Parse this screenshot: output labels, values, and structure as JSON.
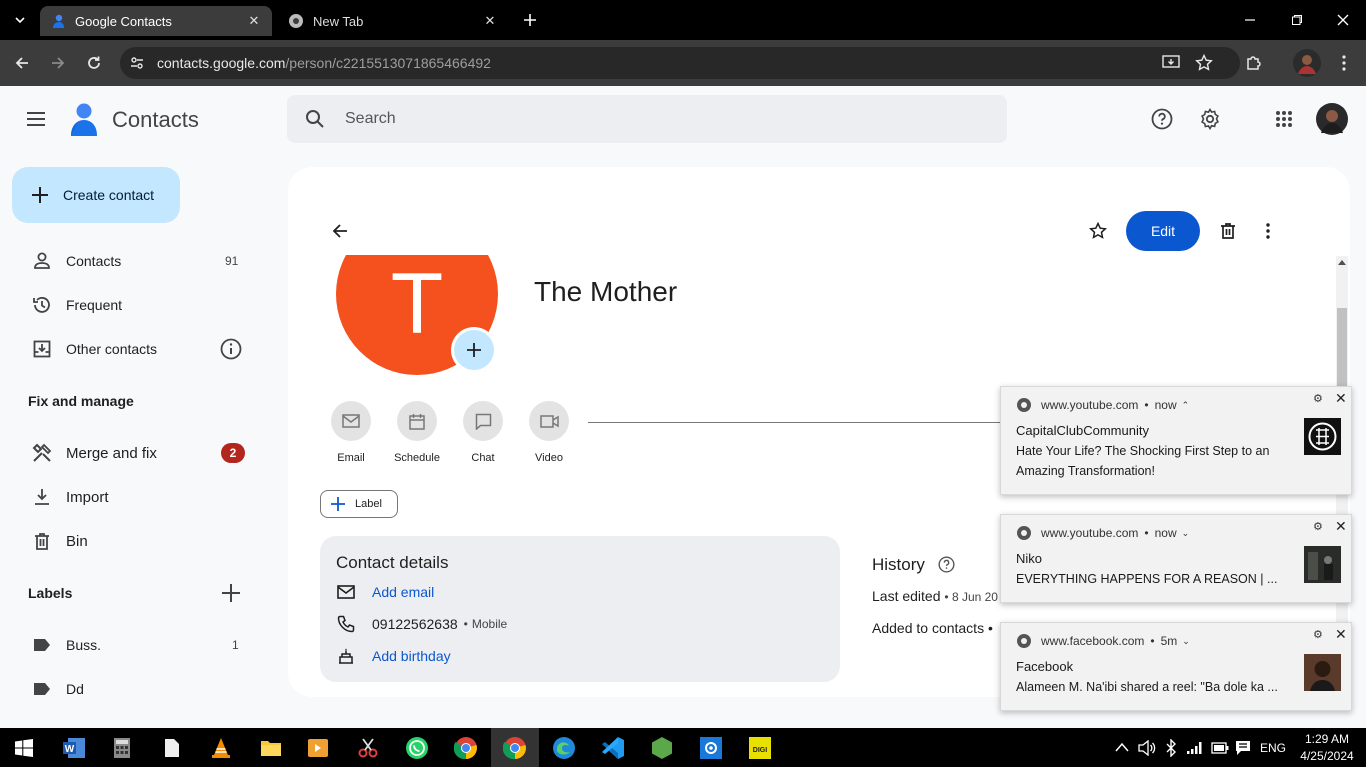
{
  "browser": {
    "tabs": [
      {
        "label": "Google Contacts",
        "active": true
      },
      {
        "label": "New Tab",
        "active": false
      }
    ],
    "url_host": "contacts.google.com",
    "url_path": "/person/c2215513071865466492"
  },
  "app": {
    "title": "Contacts",
    "search_placeholder": "Search",
    "create_label": "Create contact",
    "nav": [
      {
        "label": "Contacts",
        "count": "91",
        "icon": "person-icon"
      },
      {
        "label": "Frequent",
        "count": "",
        "icon": "history-icon"
      },
      {
        "label": "Other contacts",
        "count": "",
        "icon": "download-box-icon"
      }
    ],
    "fix_heading": "Fix and manage",
    "fix_items": [
      {
        "label": "Merge and fix",
        "badge": "2",
        "icon": "merge-icon"
      },
      {
        "label": "Import",
        "icon": "import-icon"
      },
      {
        "label": "Bin",
        "icon": "bin-icon"
      }
    ],
    "labels_heading": "Labels",
    "labels": [
      {
        "label": "Buss.",
        "count": "1"
      },
      {
        "label": "Dd",
        "count": ""
      }
    ]
  },
  "contact": {
    "initial": "T",
    "name": "The Mother",
    "avatar_color": "#f4511e",
    "edit_label": "Edit",
    "actions": [
      "Email",
      "Schedule",
      "Chat",
      "Video"
    ],
    "label_button": "Label",
    "details_title": "Contact details",
    "add_email": "Add email",
    "phone": "09122562638",
    "phone_type": "Mobile",
    "add_birthday": "Add birthday",
    "history_title": "History",
    "last_edited": "Last edited",
    "last_edited_date": "8 Jun 20",
    "added_to_contacts": "Added to contacts"
  },
  "notifications": [
    {
      "source": "www.youtube.com",
      "time": "now",
      "title": "CapitalClubCommunity",
      "body": "Hate Your Life? The Shocking First Step to an Amazing Transformation!"
    },
    {
      "source": "www.youtube.com",
      "time": "now",
      "title": "Niko",
      "body": "EVERYTHING HAPPENS FOR A REASON | ..."
    },
    {
      "source": "www.facebook.com",
      "time": "5m",
      "title": "Facebook",
      "body": "Alameen M. Na'ibi shared a reel: \"Ba dole ka ..."
    }
  ],
  "taskbar": {
    "lang": "ENG",
    "time": "1:29 AM",
    "date": "4/25/2024"
  },
  "colors": {
    "accent": "#0b57d0",
    "create_bg": "#c2e7ff",
    "badge": "#b3261e"
  }
}
